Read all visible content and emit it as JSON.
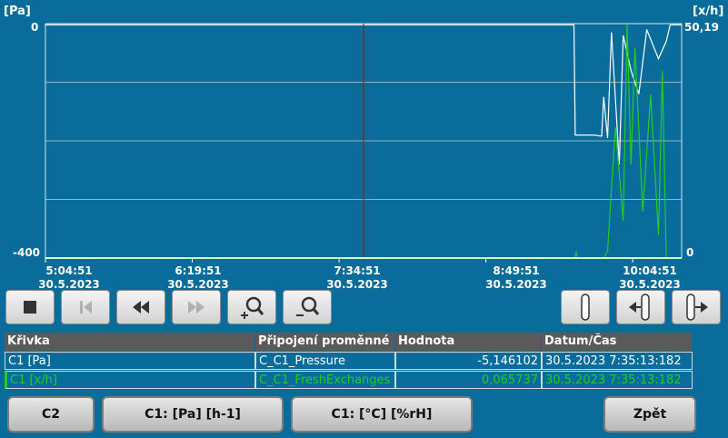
{
  "chart": {
    "left_unit": "[Pa]",
    "right_unit": "[x/h]",
    "y_left_ticks": [
      "0",
      "-400"
    ],
    "y_right_ticks": [
      "50,19",
      "0"
    ],
    "x_ticks": [
      {
        "time": "5:04:51",
        "date": "30.5.2023"
      },
      {
        "time": "6:19:51",
        "date": "30.5.2023"
      },
      {
        "time": "7:34:51",
        "date": "30.5.2023"
      },
      {
        "time": "8:49:51",
        "date": "30.5.2023"
      },
      {
        "time": "10:04:51",
        "date": "30.5.2023"
      }
    ],
    "cursor_time": "7:34:51"
  },
  "chart_data": {
    "type": "line",
    "x_range": [
      "5:04:51",
      "10:29:51"
    ],
    "y_left_range": [
      -400,
      0
    ],
    "y_right_range": [
      0,
      50.19
    ],
    "grid": true,
    "series": [
      {
        "name": "C1 [Pa]",
        "color": "#ffffff",
        "axis": "left",
        "x": [
          "5:04:51",
          "9:34:51",
          "9:35:30",
          "9:45:00",
          "9:49:00",
          "9:50:00",
          "9:52:00",
          "9:54:00",
          "9:58:00",
          "10:00:00",
          "10:04:00",
          "10:08:00",
          "10:12:00",
          "10:18:00",
          "10:22:00",
          "10:24:00",
          "10:29:51"
        ],
        "y": [
          -2,
          -2,
          -190,
          -190,
          -192,
          -125,
          -195,
          -15,
          -240,
          -20,
          -80,
          -120,
          -10,
          -60,
          -30,
          -2,
          -2
        ]
      },
      {
        "name": "C1 [x/h]",
        "color": "#22cc22",
        "axis": "right",
        "x": [
          "5:04:51",
          "9:35:00",
          "9:36:00",
          "9:37:00",
          "9:50:00",
          "9:52:00",
          "9:56:00",
          "10:00:00",
          "10:02:00",
          "10:04:00",
          "10:06:00",
          "10:10:00",
          "10:14:00",
          "10:18:00",
          "10:20:00",
          "10:22:00",
          "10:29:51"
        ],
        "y": [
          0,
          0,
          1.2,
          0,
          0,
          1.5,
          28,
          8,
          50,
          20,
          45,
          10,
          35,
          5,
          40,
          0,
          0
        ]
      }
    ]
  },
  "toolbar": {
    "buttons": [
      {
        "name": "stop-button",
        "icon": "stop-icon",
        "enabled": true
      },
      {
        "name": "first-button",
        "icon": "skip-start-icon",
        "enabled": false
      },
      {
        "name": "rewind-button",
        "icon": "rewind-icon",
        "enabled": true
      },
      {
        "name": "forward-button",
        "icon": "fast-forward-icon",
        "enabled": false
      },
      {
        "name": "zoom-in-button",
        "icon": "zoom-in-icon",
        "enabled": true
      },
      {
        "name": "zoom-out-button",
        "icon": "zoom-out-icon",
        "enabled": true
      },
      {
        "name": "ruler-button",
        "icon": "ruler-icon",
        "enabled": true
      },
      {
        "name": "ruler-left-button",
        "icon": "ruler-left-icon",
        "enabled": true
      },
      {
        "name": "ruler-right-button",
        "icon": "ruler-right-icon",
        "enabled": true
      }
    ]
  },
  "table": {
    "headers": [
      "Křivka",
      "Připojení proměnné",
      "Hodnota",
      "Datum/Čas"
    ],
    "rows": [
      {
        "curve": "C1 [Pa]",
        "variable": "C_C1_Pressure",
        "value": "-5,146102",
        "datetime": "30.5.2023 7:35:13:182",
        "color": "#ffffff"
      },
      {
        "curve": "C1 [x/h]",
        "variable": "C_C1_FreshExchanges",
        "value": "0,065737",
        "datetime": "30.5.2023 7:35:13:182",
        "color": "#22cc22"
      }
    ]
  },
  "bottom_buttons": {
    "c2": "C2",
    "pa_h": "C1: [Pa] [h-1]",
    "c_rh": "C1: [°C] [%rH]",
    "back": "Zpět"
  }
}
